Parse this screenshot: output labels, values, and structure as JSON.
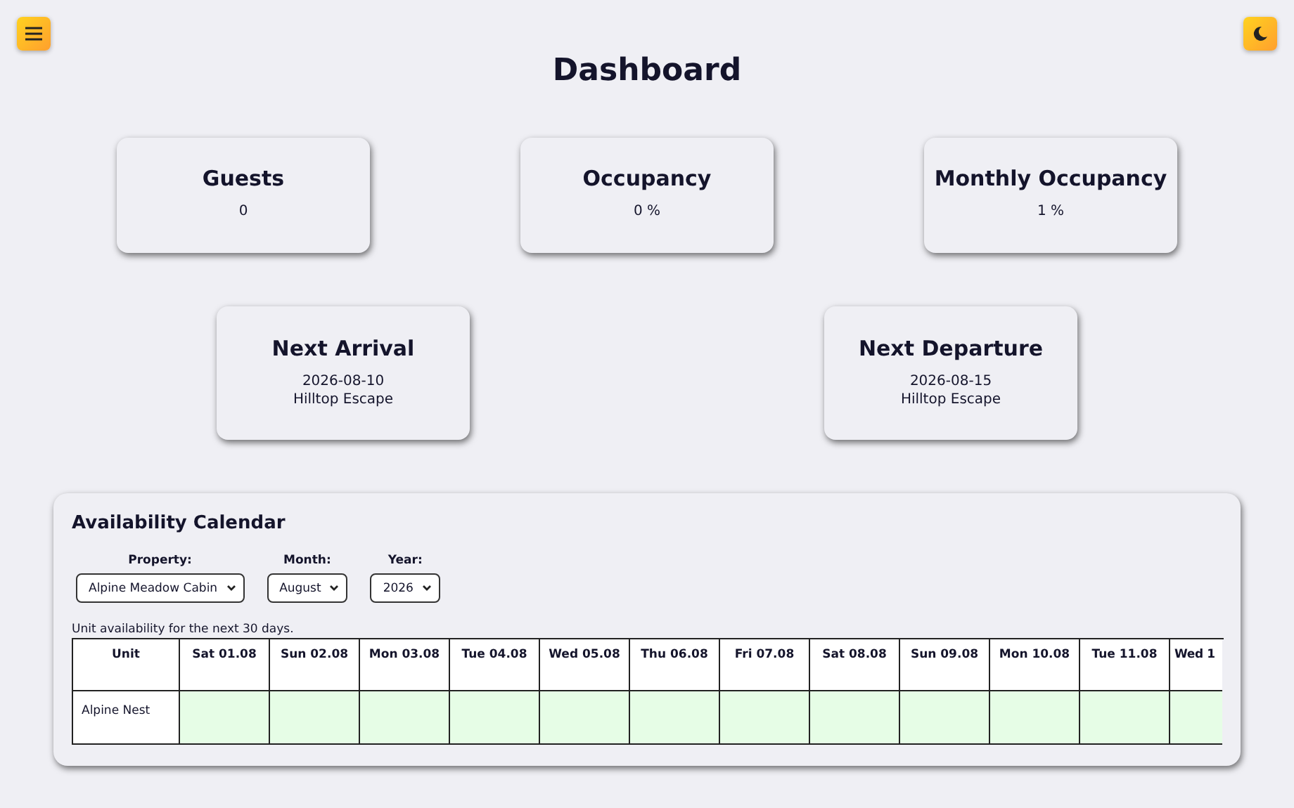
{
  "title": "Dashboard",
  "stats": [
    {
      "label": "Guests",
      "lines": [
        "0"
      ]
    },
    {
      "label": "Occupancy",
      "lines": [
        "0 %"
      ]
    },
    {
      "label": "Monthly Occupancy",
      "lines": [
        "1 %"
      ]
    }
  ],
  "events": [
    {
      "label": "Next Arrival",
      "lines": [
        "2026-08-10",
        "Hilltop Escape"
      ]
    },
    {
      "label": "Next Departure",
      "lines": [
        "2026-08-15",
        "Hilltop Escape"
      ]
    }
  ],
  "calendar": {
    "title": "Availability Calendar",
    "filters": [
      {
        "label": "Property:",
        "value": "Alpine Meadow Cabin"
      },
      {
        "label": "Month:",
        "value": "August"
      },
      {
        "label": "Year:",
        "value": "2026"
      }
    ],
    "caption": "Unit availability for the next 30 days.",
    "columns": [
      "Unit",
      "Sat 01.08",
      "Sun 02.08",
      "Mon 03.08",
      "Tue 04.08",
      "Wed 05.08",
      "Thu 06.08",
      "Fri 07.08",
      "Sat 08.08",
      "Sun 09.08",
      "Mon 10.08",
      "Tue 11.08",
      "Wed 1"
    ],
    "rows": [
      {
        "unit": "Alpine Nest",
        "days": [
          {
            "available": true
          },
          {
            "available": true
          },
          {
            "available": true
          },
          {
            "available": true
          },
          {
            "available": true
          },
          {
            "available": true
          },
          {
            "available": true
          },
          {
            "available": true
          },
          {
            "available": true
          },
          {
            "available": true
          },
          {
            "available": true
          },
          {
            "available": true
          }
        ]
      }
    ]
  }
}
